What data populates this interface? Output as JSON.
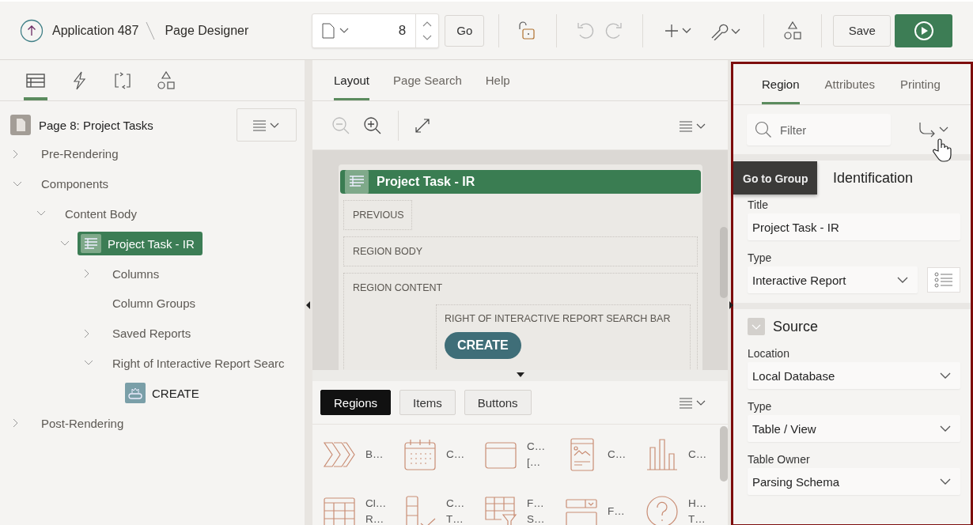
{
  "header": {
    "app_link": "Application 487",
    "page_title": "Page Designer",
    "page_number": "8",
    "go_button": "Go",
    "undo_disabled": true,
    "redo_disabled": true,
    "save_button": "Save"
  },
  "left_tabs": [
    {
      "kind": "rendering",
      "selected": true
    },
    {
      "kind": "dynamic-actions",
      "selected": false
    },
    {
      "kind": "processing",
      "selected": false
    },
    {
      "kind": "shared-components",
      "selected": false
    }
  ],
  "tree": {
    "page_label": "Page 8: Project Tasks",
    "nodes": [
      {
        "label": "Pre-Rendering",
        "expanded": false,
        "selected": false
      },
      {
        "label": "Components",
        "expanded": true,
        "selected": false,
        "children": [
          {
            "label": "Content Body",
            "expanded": true,
            "selected": false,
            "children": [
              {
                "label": "Project Task - IR",
                "kind": "region",
                "expanded": true,
                "selected": true,
                "children": [
                  {
                    "label": "Columns",
                    "expanded": false,
                    "selected": false
                  },
                  {
                    "label": "Column Groups",
                    "selected": false
                  },
                  {
                    "label": "Saved Reports",
                    "expanded": false,
                    "selected": false
                  },
                  {
                    "label": "Right of Interactive Report Searc",
                    "expanded": true,
                    "selected": false,
                    "children": [
                      {
                        "label": "CREATE",
                        "kind": "button",
                        "selected": false
                      }
                    ]
                  }
                ]
              }
            ]
          }
        ]
      },
      {
        "label": "Post-Rendering",
        "expanded": false,
        "selected": false
      }
    ]
  },
  "middle_tabs": [
    {
      "label": "Layout",
      "selected": true
    },
    {
      "label": "Page Search",
      "selected": false
    },
    {
      "label": "Help",
      "selected": false
    }
  ],
  "layout_toolbar": {
    "zoom_out_disabled": true
  },
  "canvas": {
    "region_title": "Project Task - IR",
    "previous_slot": "PREVIOUS",
    "body_slot": "REGION BODY",
    "content_slot": "REGION CONTENT",
    "search_bar_slot": "RIGHT OF INTERACTIVE REPORT SEARCH BAR",
    "create_button": "CREATE"
  },
  "palette": {
    "tabs": [
      {
        "label": "Regions",
        "selected": true
      },
      {
        "label": "Items",
        "selected": false
      },
      {
        "label": "Buttons",
        "selected": false
      }
    ],
    "items": [
      {
        "kind": "breadcrumb",
        "lines": [
          "B…"
        ]
      },
      {
        "kind": "calendar",
        "lines": [
          "C…"
        ]
      },
      {
        "kind": "window",
        "lines": [
          "C…",
          "[…"
        ]
      },
      {
        "kind": "card",
        "lines": [
          "C…"
        ]
      },
      {
        "kind": "chart",
        "lines": [
          "C…"
        ]
      },
      {
        "kind": "grid",
        "lines": [
          "Cl…",
          "R…"
        ]
      },
      {
        "kind": "checklist",
        "lines": [
          "C…",
          "T…"
        ]
      },
      {
        "kind": "filter-grid",
        "lines": [
          "F…",
          "S…"
        ]
      },
      {
        "kind": "form",
        "lines": [
          "F…"
        ]
      },
      {
        "kind": "help",
        "lines": [
          "H…",
          "T…"
        ]
      }
    ]
  },
  "property_tabs": [
    {
      "label": "Region",
      "selected": true
    },
    {
      "label": "Attributes",
      "selected": false
    },
    {
      "label": "Printing",
      "selected": false
    }
  ],
  "filter": {
    "placeholder": "Filter"
  },
  "tooltip": "Go to Group",
  "sections": [
    {
      "title": "Identification",
      "fields": [
        {
          "label": "Title",
          "kind": "text",
          "value": "Project Task - IR"
        },
        {
          "label": "Type",
          "kind": "select-with-list",
          "value": "Interactive Report"
        }
      ]
    },
    {
      "title": "Source",
      "fields": [
        {
          "label": "Location",
          "kind": "select",
          "value": "Local Database"
        },
        {
          "label": "Type",
          "kind": "select",
          "value": "Table / View"
        },
        {
          "label": "Table Owner",
          "kind": "select",
          "value": "Parsing Schema"
        }
      ]
    }
  ]
}
